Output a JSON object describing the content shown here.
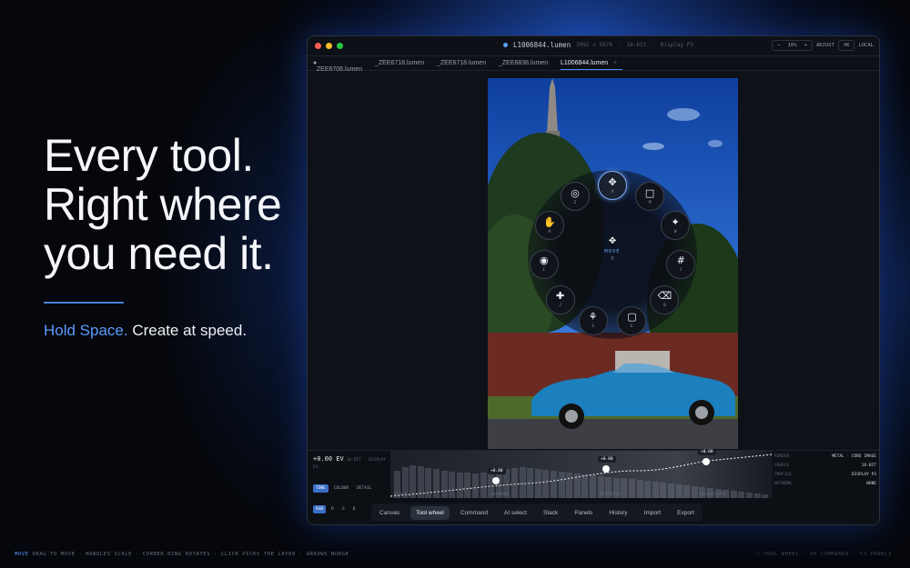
{
  "hero": {
    "headline_1": "Every tool.",
    "headline_2": "Right where",
    "headline_3": "you need it.",
    "sub_accent": "Hold Space.",
    "sub_rest": " Create at speed."
  },
  "window": {
    "title": "L1006844.lumen",
    "meta_dims": "3992 × 5976",
    "meta_depth": "16-bit",
    "meta_profile": "Display P3",
    "zoom_minus": "−",
    "zoom_value": "16%",
    "zoom_plus": "+",
    "adjust_label": "ADJUST",
    "cmd_label": "⌘K",
    "local_label": "LOCAL",
    "colors": {
      "close": "#ff5f57",
      "minimize": "#febc2e",
      "zoom": "#28c840",
      "accent": "#5b9bff"
    }
  },
  "tabs": [
    {
      "label": "_ZEE6706.lumen",
      "dirty": true
    },
    {
      "label": "_ZEE6718.lumen"
    },
    {
      "label": "_ZEE6718.lumen"
    },
    {
      "label": "_ZEE6838.lumen"
    },
    {
      "label": "L1006844.lumen",
      "active": true,
      "close": "×"
    }
  ],
  "wheel": {
    "center_label": "MOVE",
    "center_key": "V",
    "items": [
      {
        "icon": "move-icon",
        "glyph": "✥",
        "key": "V",
        "selected": true
      },
      {
        "icon": "square-icon",
        "glyph": "□",
        "key": "M"
      },
      {
        "icon": "sparkle-icon",
        "glyph": "✦",
        "key": "W"
      },
      {
        "icon": "hash-icon",
        "glyph": "#",
        "key": "C"
      },
      {
        "icon": "eraser-icon",
        "glyph": "⌫",
        "key": "B"
      },
      {
        "icon": "crop-icon",
        "glyph": "▢",
        "key": "E"
      },
      {
        "icon": "stamp-icon",
        "glyph": "⚘",
        "key": "S"
      },
      {
        "icon": "heal-icon",
        "glyph": "✚",
        "key": "J"
      },
      {
        "icon": "lasso-icon",
        "glyph": "◉",
        "key": "I"
      },
      {
        "icon": "hand-icon",
        "glyph": "✋",
        "key": "H"
      },
      {
        "icon": "target-icon",
        "glyph": "◎",
        "key": "Z"
      }
    ]
  },
  "adjust": {
    "ev": "+0.00 EV",
    "ev_meta": "16-BIT · DISPLAY P3",
    "mode_chips": [
      {
        "label": "TONE",
        "on": true
      },
      {
        "label": "COLOUR"
      },
      {
        "label": "DETAIL"
      }
    ],
    "channel_chips": [
      {
        "label": "RGB",
        "on": true
      },
      {
        "label": "R"
      },
      {
        "label": "G"
      },
      {
        "label": "B"
      }
    ],
    "hist_labels": [
      "BLACK",
      "SHADOWS",
      "MIDTONES",
      "HIGHLIGHTS"
    ],
    "pins": [
      {
        "label": "+0.00"
      },
      {
        "label": "+0.00"
      },
      {
        "label": "+0.00"
      }
    ]
  },
  "info": [
    {
      "k": "RENDER",
      "v": "METAL · CORE IMAGE"
    },
    {
      "k": "SOURCE",
      "v": "16-BIT"
    },
    {
      "k": "PROFILE",
      "v": "DISPLAY P3"
    },
    {
      "k": "NETWORK",
      "v": "NONE"
    }
  ],
  "dock": [
    "Canvas",
    "Tool wheel",
    "Command",
    "AI select",
    "Stack",
    "Panels",
    "History",
    "Import",
    "Export"
  ],
  "dock_active": "Tool wheel",
  "footer": {
    "lead": "MOVE",
    "text": " DRAG TO MOVE · HANDLES SCALE · CORNER RING ROTATES · CLICK PICKS THE LAYER · ARROWS NUDGE",
    "right": "⌥ TOOL WHEEL · ⌘K COMMANDS · ⌘J PANELS"
  }
}
